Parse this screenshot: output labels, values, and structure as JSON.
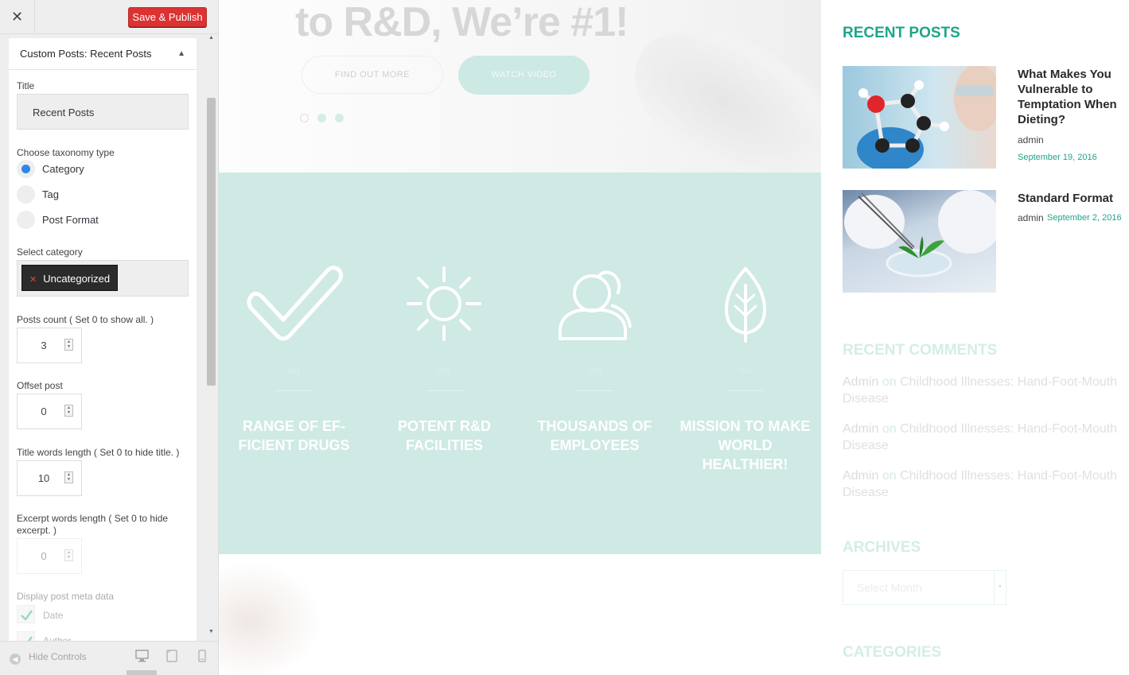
{
  "customizer": {
    "close_label": "✕",
    "save_label": "Save & Publish",
    "section_prefix": "Custom Posts:",
    "section_name": "Recent Posts",
    "title_label": "Title",
    "title_value": "Recent Posts",
    "taxonomy_label": "Choose taxonomy type",
    "taxonomy_options": [
      {
        "label": "Category",
        "selected": true
      },
      {
        "label": "Tag",
        "selected": false
      },
      {
        "label": "Post Format",
        "selected": false
      }
    ],
    "select_category_label": "Select category",
    "selected_category": "Uncategorized",
    "posts_count_label": "Posts count ( Set 0 to show all. )",
    "posts_count": "3",
    "offset_label": "Offset post",
    "offset": "0",
    "title_words_label": "Title words length ( Set 0 to hide title. )",
    "title_words": "10",
    "excerpt_words_label": "Excerpt words length ( Set 0 to hide excerpt. )",
    "excerpt_words": "0",
    "meta_label": "Display post meta data",
    "meta_date_label": "Date",
    "meta_author_label": "Author",
    "hide_controls_label": "Hide Controls",
    "device_icons": [
      "desktop-icon",
      "tablet-icon",
      "mobile-icon"
    ]
  },
  "hero": {
    "title": "to R&D, We’re #1!",
    "btn_find": "FIND OUT MORE",
    "btn_video": "WATCH VIDEO",
    "slide_dots": 3
  },
  "features": [
    {
      "num": "001",
      "title": "RANGE OF EF-FICIENT DRUGS",
      "icon": "check-icon"
    },
    {
      "num": "002",
      "title": "POTENT R&D FACILITIES",
      "icon": "sun-icon"
    },
    {
      "num": "003",
      "title": "THOUSANDS OF EMPLOYEES",
      "icon": "user-icon"
    },
    {
      "num": "004",
      "title": "MISSION TO MAKE WORLD HEALTHIER!",
      "icon": "leaf-icon"
    }
  ],
  "widgets": {
    "recent_posts_title": "RECENT POSTS",
    "posts": [
      {
        "title": "What Makes You Vulnerable to Temptation When Dieting?",
        "author": "admin",
        "date": "September 19, 2016"
      },
      {
        "title": "Standard Format",
        "author": "admin",
        "date": "September 2, 2016"
      }
    ],
    "recent_comments_title": "RECENT COMMENTS",
    "comments": [
      {
        "author": "Admin",
        "on": "on",
        "post": "Childhood Illnesses: Hand-Foot-Mouth Disease"
      },
      {
        "author": "Admin",
        "on": "on",
        "post": "Childhood Illnesses: Hand-Foot-Mouth Disease"
      },
      {
        "author": "Admin",
        "on": "on",
        "post": "Childhood Illnesses: Hand-Foot-Mouth Disease"
      }
    ],
    "archives_title": "ARCHIVES",
    "archives_select": "Select Month",
    "categories_title": "CATEGORIES"
  },
  "colors": {
    "accent": "#1fa58c",
    "save_button": "#dc3232",
    "feature_bg": "#cfe9e4",
    "radio_selected": "#2f86e6"
  }
}
